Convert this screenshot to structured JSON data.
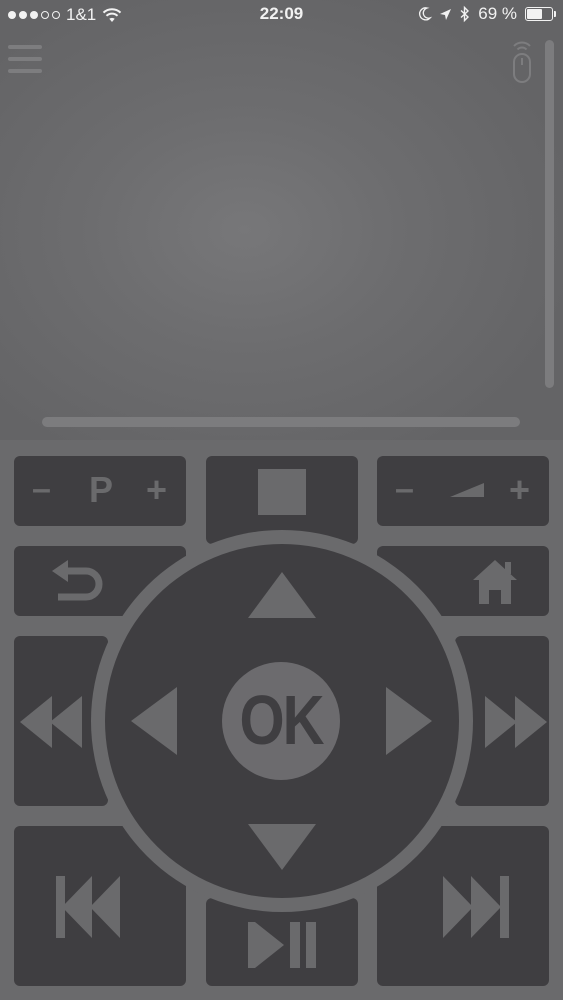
{
  "status_bar": {
    "carrier": "1&1",
    "time": "22:09",
    "battery": "69 %",
    "battery_level": 0.69,
    "signal_strength": 3,
    "signal_max": 5
  },
  "remote": {
    "channel_minus": "–",
    "channel_label": "P",
    "channel_plus": "+",
    "volume_minus": "–",
    "volume_plus": "+",
    "ok_label": "OK"
  },
  "colors": {
    "background": "#6a6a6c",
    "button": "#3f3e41",
    "glyph": "#6a6a6c"
  }
}
